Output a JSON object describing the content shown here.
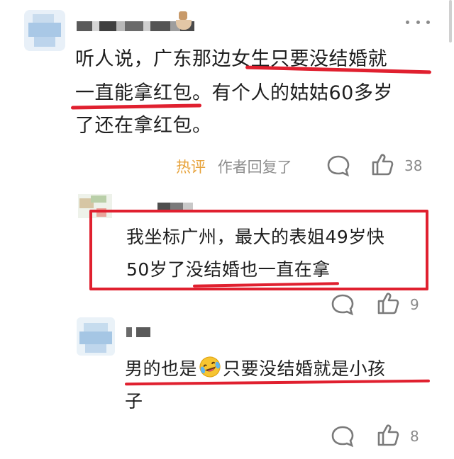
{
  "comment1": {
    "lines": [
      "听人说，广东那边女生只要没结婚就",
      "一直能拿红包。有个人的姑姑60多岁",
      "了还在拿红包。"
    ],
    "hot_label": "热评",
    "author_replied": "作者回复了",
    "like_count": "38"
  },
  "reply1": {
    "lines": [
      "我坐标广州，最大的表姐49岁快",
      "50岁了没结婚也一直在拿"
    ],
    "like_count": "9"
  },
  "reply2": {
    "line1_before_emoji": "男的也是",
    "line1_after_emoji": "只要没结婚就是小孩",
    "line2": "子",
    "like_count": "8"
  },
  "icons": {
    "more": "more-dots-icon",
    "comment": "comment-bubble-icon",
    "like": "thumbs-up-icon",
    "emoji": "laughing-tears-emoji-icon"
  },
  "colors": {
    "annotation_red": "#e0202f",
    "hot_label": "#e7a33c",
    "meta_gray": "#8f8f8f"
  }
}
